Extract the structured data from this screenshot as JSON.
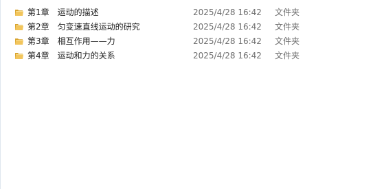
{
  "files": [
    {
      "name": "第1章　运动的描述",
      "modified": "2025/4/28 16:42",
      "type": "文件夹",
      "icon": "folder-icon"
    },
    {
      "name": "第2章　匀变速直线运动的研究",
      "modified": "2025/4/28 16:42",
      "type": "文件夹",
      "icon": "folder-icon"
    },
    {
      "name": "第3章　相互作用——力",
      "modified": "2025/4/28 16:42",
      "type": "文件夹",
      "icon": "folder-icon"
    },
    {
      "name": "第4章　运动和力的关系",
      "modified": "2025/4/28 16:42",
      "type": "文件夹",
      "icon": "folder-icon"
    }
  ],
  "colors": {
    "folder_front": "#f2c55c",
    "folder_back": "#d9a531",
    "text": "#1e1e1e",
    "meta_text": "#6d6d6d"
  }
}
